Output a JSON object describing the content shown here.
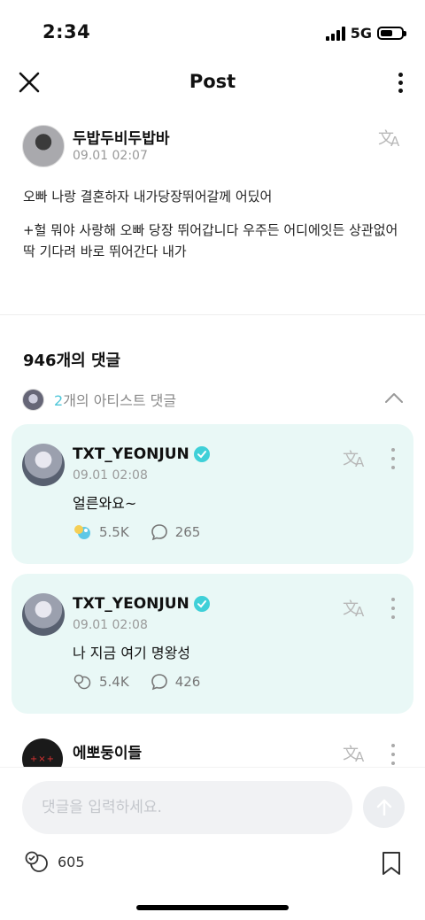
{
  "status": {
    "time": "2:34",
    "network": "5G"
  },
  "header": {
    "title": "Post"
  },
  "post": {
    "author": "두밥두비두밥바",
    "time": "09.01 02:07",
    "body": [
      "오빠 나랑 결혼하자 내가당장뛰어갈께 어딨어",
      "+헐 뭐야 사랑해 오빠 당장 뛰어갑니다 우주든 어디에잇든 상관없어 딱 기다려 바로 뛰어간다 내가"
    ]
  },
  "comments": {
    "count_label": "946개의 댓글",
    "artist_count": "2",
    "artist_label": "개의 아티스트 댓글",
    "artist_comments": [
      {
        "name": "TXT_YEONJUN",
        "time": "09.01 02:08",
        "text": "얼른와요~",
        "likes": "5.5K",
        "replies": "265"
      },
      {
        "name": "TXT_YEONJUN",
        "time": "09.01 02:08",
        "text": "나 지금 여기 명왕성",
        "likes": "5.4K",
        "replies": "426"
      }
    ],
    "next_comment": {
      "name": "에뽀둥이들",
      "avatar_text": "+×+"
    }
  },
  "composer": {
    "placeholder": "댓글을 입력하세요.",
    "like_count": "605"
  },
  "colors": {
    "accent": "#4dc6d8",
    "artist_card_bg": "#e9f8f6",
    "verified": "#3fd0d8"
  }
}
